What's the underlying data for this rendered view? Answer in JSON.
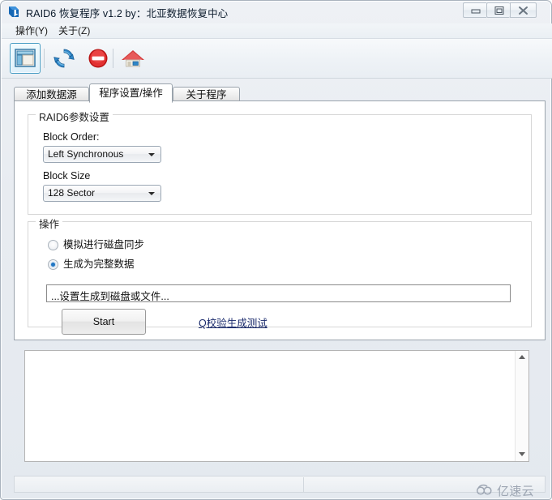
{
  "window": {
    "title": "RAID6 恢复程序 v1.2 by：北亚数据恢复中心",
    "app_icon": "raid-app-icon",
    "controls": {
      "minimize": "minimize-icon",
      "maximize": "maximize-icon",
      "close": "close-icon"
    }
  },
  "menubar": {
    "items": [
      {
        "label": "操作(Y)"
      },
      {
        "label": "关于(Z)"
      }
    ]
  },
  "toolbar": {
    "buttons": [
      {
        "icon": "panel-layout-icon",
        "active": true
      },
      {
        "icon": "refresh-icon",
        "active": false
      },
      {
        "icon": "stop-icon",
        "active": false
      },
      {
        "icon": "home-icon",
        "active": false
      }
    ]
  },
  "tabs": [
    {
      "label": "添加数据源",
      "selected": false
    },
    {
      "label": "程序设置/操作",
      "selected": true
    },
    {
      "label": "关于程序",
      "selected": false
    }
  ],
  "params_group": {
    "title": "RAID6参数设置",
    "block_order_label": "Block Order:",
    "block_order_value": "Left Synchronous",
    "block_size_label": "Block Size",
    "block_size_value": "128 Sector"
  },
  "operations_group": {
    "title": "操作",
    "radio_simulate": "模拟进行磁盘同步",
    "radio_generate": "生成为完整数据",
    "path_value": "...设置生成到磁盘或文件...",
    "start_label": "Start",
    "link_label": "Q校验生成测试"
  },
  "log_panel": {
    "content": ""
  },
  "statusbar": {
    "left_text": "",
    "right_text": ""
  },
  "watermark": {
    "text": "亿速云",
    "icon": "cloud-logo-icon"
  },
  "colors": {
    "accent_blue": "#2277c4",
    "stop_red": "#d02020",
    "link_navy": "#1a2a6c",
    "tab_border": "#9aa3ac"
  }
}
